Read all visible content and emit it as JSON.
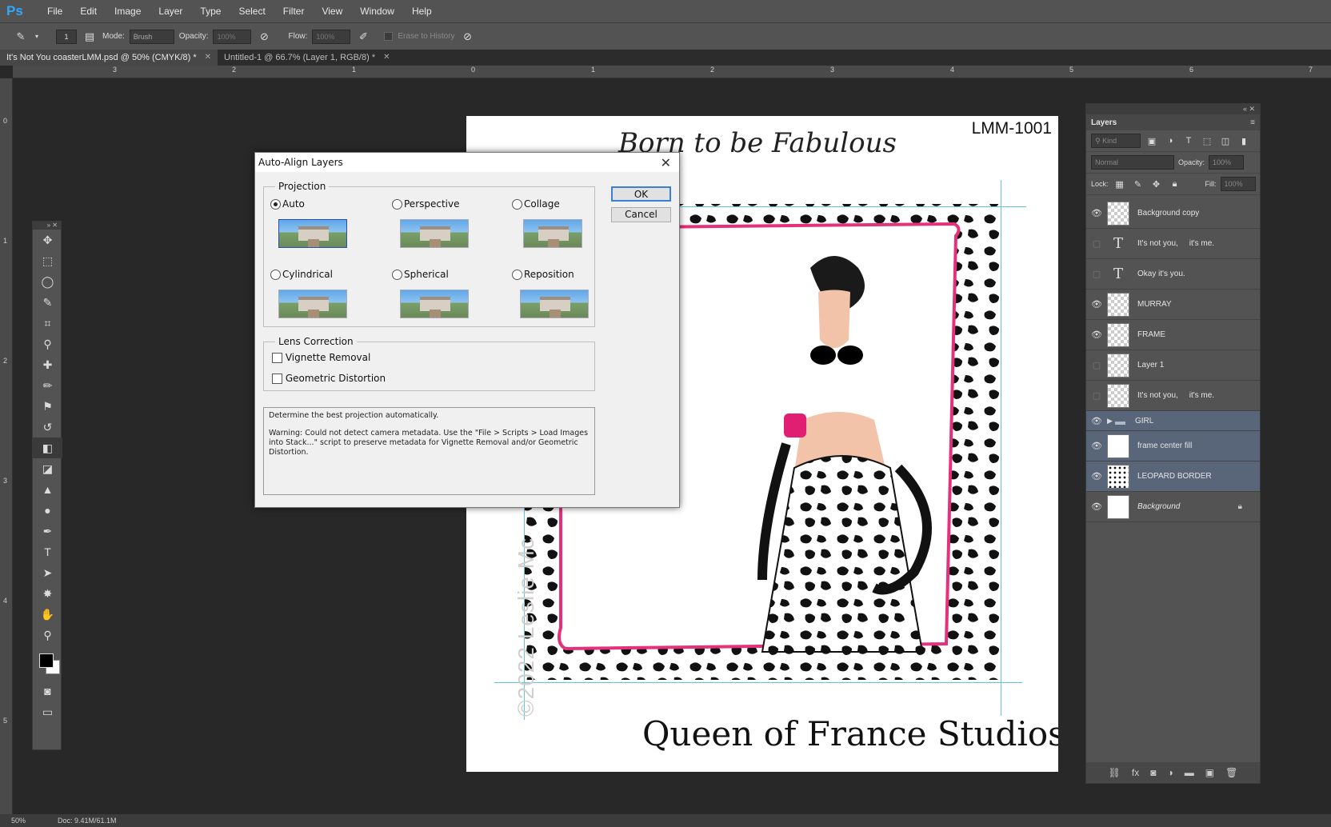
{
  "app": {
    "logo": "Ps"
  },
  "menu": [
    "File",
    "Edit",
    "Image",
    "Layer",
    "Type",
    "Select",
    "Filter",
    "View",
    "Window",
    "Help"
  ],
  "options": {
    "brush_size": "1",
    "mode_label": "Mode:",
    "mode_value": "Brush",
    "opacity_label": "Opacity:",
    "opacity_value": "100%",
    "flow_label": "Flow:",
    "flow_value": "100%",
    "erase_history_label": "Erase to History"
  },
  "tabs": [
    {
      "label": "It's Not You coasterLMM.psd @ 50% (CMYK/8) *"
    },
    {
      "label": "Untitled-1 @ 66.7% (Layer 1, RGB/8) *"
    }
  ],
  "ruler_h": [
    "3",
    "2",
    "1",
    "0",
    "1",
    "2",
    "3",
    "4",
    "5",
    "6",
    "7"
  ],
  "ruler_v": [
    "0",
    "1",
    "2",
    "3",
    "4",
    "5"
  ],
  "canvas": {
    "code": "LMM-1001",
    "tagline": "Born to be Fabulous",
    "studio": "Queen of France Studios",
    "tm": "™",
    "copyright": "©2022 Leslie Mc"
  },
  "dialog": {
    "title": "Auto-Align Layers",
    "projection_legend": "Projection",
    "options": [
      {
        "label": "Auto",
        "selected": true
      },
      {
        "label": "Perspective",
        "selected": false
      },
      {
        "label": "Collage",
        "selected": false
      },
      {
        "label": "Cylindrical",
        "selected": false
      },
      {
        "label": "Spherical",
        "selected": false
      },
      {
        "label": "Reposition",
        "selected": false
      }
    ],
    "lens_legend": "Lens Correction",
    "vignette": "Vignette Removal",
    "geometric": "Geometric Distortion",
    "ok": "OK",
    "cancel": "Cancel",
    "info_line1": "Determine the best projection automatically.",
    "info_line2": "Warning: Could not detect camera metadata. Use the \"File > Scripts > Load Images into Stack...\" script to preserve metadata for Vignette Removal and/or Geometric Distortion."
  },
  "layers_panel": {
    "title": "Layers",
    "kind": "Kind",
    "blend": "Normal",
    "opacity_label": "Opacity:",
    "opacity_value": "100%",
    "lock_label": "Lock:",
    "fill_label": "Fill:",
    "fill_value": "100%",
    "layers": [
      {
        "name": "Background copy",
        "visible": true,
        "thumb": "checker"
      },
      {
        "name": "It's not you,     it's me.",
        "visible": false,
        "thumb": "text"
      },
      {
        "name": "Okay it's you.",
        "visible": false,
        "thumb": "text"
      },
      {
        "name": "MURRAY",
        "visible": true,
        "thumb": "checker"
      },
      {
        "name": "FRAME",
        "visible": true,
        "thumb": "checker"
      },
      {
        "name": "Layer 1",
        "visible": false,
        "thumb": "checker"
      },
      {
        "name": "It's not you,     it's me.",
        "visible": false,
        "thumb": "checker"
      },
      {
        "name": "GIRL",
        "visible": true,
        "thumb": "folder"
      },
      {
        "name": "frame center fill",
        "visible": true,
        "thumb": "solid"
      },
      {
        "name": "LEOPARD BORDER",
        "visible": true,
        "thumb": "leo"
      },
      {
        "name": "Background",
        "visible": true,
        "thumb": "solid"
      }
    ]
  },
  "status": {
    "zoom": "50%",
    "doc": "Doc: 9.41M/61.1M"
  }
}
